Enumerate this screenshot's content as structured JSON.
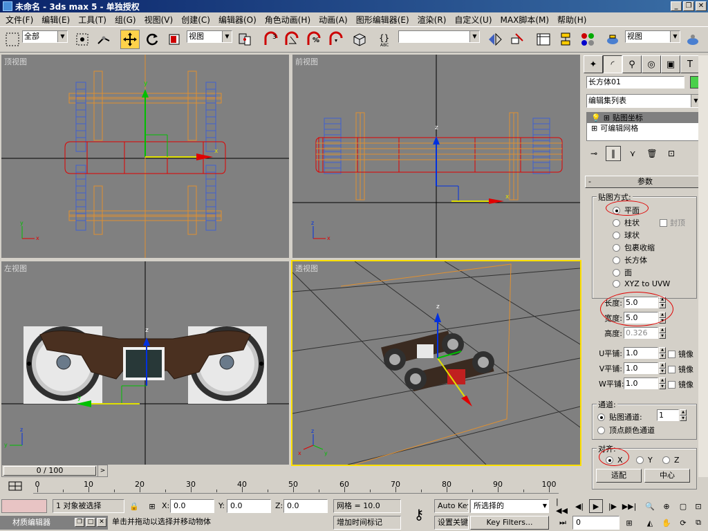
{
  "title": "未命名 - 3ds max 5 - 单独授权",
  "window_buttons": [
    "_",
    "❐",
    "✕"
  ],
  "menu": [
    "文件(F)",
    "编辑(E)",
    "工具(T)",
    "组(G)",
    "视图(V)",
    "创建(C)",
    "编辑器(O)",
    "角色动画(H)",
    "动画(A)",
    "图形编辑器(E)",
    "渲染(R)",
    "自定义(U)",
    "MAX脚本(M)",
    "帮助(H)"
  ],
  "toolbar": {
    "selection_filter": "全部",
    "reference_coord": "视图",
    "named_selection": "",
    "render_view": "视图",
    "icons": [
      "select-region-icon",
      "select-object-icon",
      "select-move-icon",
      "select-rotate-icon",
      "select-scale-icon",
      "snap-3d-icon",
      "angle-snap-icon",
      "percent-snap-icon",
      "spinner-snap-icon",
      "named-sel-icon",
      "mirror-icon",
      "align-icon",
      "track-view-icon",
      "schematic-icon",
      "material-editor-icon",
      "render-scene-icon",
      "quick-render-icon"
    ],
    "snap_labels": [
      "3",
      "%"
    ],
    "abc_label": "ABC"
  },
  "viewports": {
    "top": "顶视图",
    "front": "前视图",
    "left": "左视图",
    "persp": "透视图"
  },
  "axis": {
    "x": "x",
    "y": "y",
    "z": "z"
  },
  "command_panel": {
    "object_name": "长方体01",
    "object_color": "#4ad04a",
    "modifier_list": "编辑集列表",
    "stack": [
      {
        "label": "贴图坐标",
        "selected": true
      },
      {
        "label": "可编辑网格",
        "selected": false
      }
    ],
    "rollout_title": "参数",
    "mapping": {
      "label": "贴图方式:",
      "options": [
        "平面",
        "柱状",
        "球状",
        "包裹收缩",
        "长方体",
        "面",
        "XYZ to UVW"
      ],
      "selected": "平面",
      "cap_label": "封顶"
    },
    "dimensions": [
      {
        "label": "长度:",
        "value": "5.0",
        "enabled": true
      },
      {
        "label": "宽度:",
        "value": "5.0",
        "enabled": true
      },
      {
        "label": "高度:",
        "value": "0.326",
        "enabled": false
      }
    ],
    "tiling": [
      {
        "label": "U平铺:",
        "value": "1.0",
        "flip": "镜像"
      },
      {
        "label": "V平铺:",
        "value": "1.0",
        "flip": "镜像"
      },
      {
        "label": "W平铺:",
        "value": "1.0",
        "flip": "镜像"
      }
    ],
    "channel": {
      "label": "通道:",
      "map_channel_label": "贴图通道:",
      "map_channel_value": "1",
      "vertex_color_label": "顶点颜色通道"
    },
    "alignment": {
      "label": "对齐:",
      "options": [
        "X",
        "Y",
        "Z"
      ],
      "selected": "X",
      "fit_button": "适配",
      "center_button": "中心"
    }
  },
  "time": {
    "slider": "0 / 100",
    "ticks": [
      "0",
      "10",
      "20",
      "30",
      "40",
      "50",
      "60",
      "70",
      "80",
      "90",
      "100"
    ]
  },
  "status": {
    "selection": "1 对象被选择",
    "x_label": "X:",
    "x_value": "0.0",
    "y_label": "Y:",
    "y_value": "0.0",
    "z_label": "Z:",
    "z_value": "0.0",
    "grid": "网格 = 10.0",
    "prompt": "单击并拖动以选择并移动物体",
    "add_time_tag": "增加时间标记",
    "auto_key": "Auto Key",
    "set_key": "设置关键帧",
    "key_mode": "所选择的",
    "key_filters": "Key Filters...",
    "current_frame": "0"
  },
  "material_editor_bar": "材质编辑器"
}
